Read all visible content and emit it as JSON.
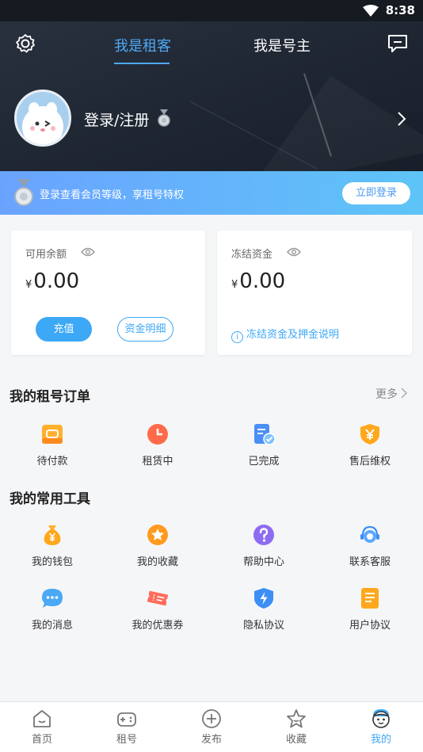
{
  "status_bar": {
    "time": "8:38"
  },
  "header": {
    "tabs": [
      {
        "label": "我是租客",
        "active": true
      },
      {
        "label": "我是号主",
        "active": false
      }
    ],
    "login_label": "登录/注册"
  },
  "banner": {
    "text": "登录查看会员等级，享租号特权",
    "button": "立即登录"
  },
  "balance": {
    "available_label": "可用余额",
    "available_currency": "¥",
    "available_amount": "0.00",
    "recharge_button": "充值",
    "detail_button": "资金明细",
    "frozen_label": "冻结资金",
    "frozen_currency": "¥",
    "frozen_amount": "0.00",
    "frozen_info": "冻结资金及押金说明"
  },
  "orders": {
    "title": "我的租号订单",
    "more": "更多",
    "items": [
      {
        "label": "待付款",
        "icon": "wallet-pending-icon"
      },
      {
        "label": "租赁中",
        "icon": "clock-icon"
      },
      {
        "label": "已完成",
        "icon": "document-check-icon"
      },
      {
        "label": "售后维权",
        "icon": "shield-yen-icon"
      }
    ]
  },
  "tools": {
    "title": "我的常用工具",
    "items": [
      {
        "label": "我的钱包",
        "icon": "money-bag-icon"
      },
      {
        "label": "我的收藏",
        "icon": "star-icon"
      },
      {
        "label": "帮助中心",
        "icon": "question-icon"
      },
      {
        "label": "联系客服",
        "icon": "customer-service-icon"
      },
      {
        "label": "我的消息",
        "icon": "chat-bubble-icon"
      },
      {
        "label": "我的优惠券",
        "icon": "coupon-icon"
      },
      {
        "label": "隐私协议",
        "icon": "shield-bolt-icon"
      },
      {
        "label": "用户协议",
        "icon": "document-icon"
      }
    ]
  },
  "bottom_nav": {
    "items": [
      {
        "label": "首页",
        "icon": "home-icon",
        "active": false
      },
      {
        "label": "租号",
        "icon": "gamepad-icon",
        "active": false
      },
      {
        "label": "发布",
        "icon": "plus-circle-icon",
        "active": false
      },
      {
        "label": "收藏",
        "icon": "star-outline-icon",
        "active": false
      },
      {
        "label": "我的",
        "icon": "profile-face-icon",
        "active": true
      }
    ]
  },
  "colors": {
    "accent": "#3da8f5",
    "header_bg": "#1e2531",
    "banner_start": "#6aa3ff",
    "banner_end": "#5ec4f7"
  }
}
